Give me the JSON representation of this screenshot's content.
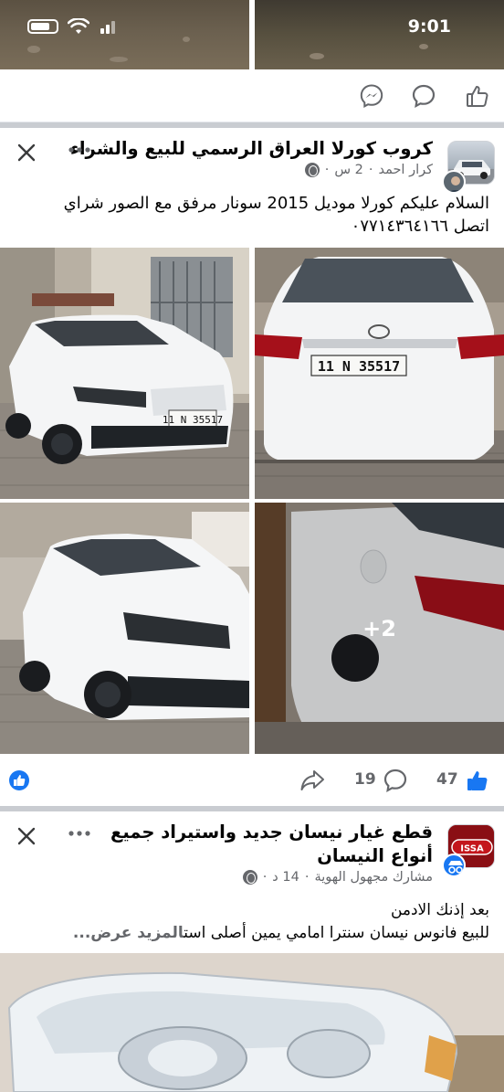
{
  "status_bar": {
    "time": "9:01"
  },
  "colors": {
    "accent": "#1877f2",
    "secondary_text": "#65676b",
    "brand_badge": "#c4161c"
  },
  "post1": {
    "group_name": "كروب كورلا العراق الرسمي للبيع والشراء",
    "author": "كرار احمد",
    "time": "2 س",
    "text_line1": "السلام عليكم كورلا موديل 2015 سونار مرفق مع الصور شراي",
    "text_line2": "اتصل ٠٧٧١٤٣٦٤١٦٦",
    "plate": "11 N 35517",
    "more_photos": "+2",
    "likes": "47",
    "comments": "19"
  },
  "post2": {
    "page_name_line1": "قطع غيار نيسان جديد واستيراد جميع",
    "page_name_line2": "أنواع النيسان",
    "author": "مشارك مجهول الهوية",
    "time": "14 د",
    "line1": "بعد إذنك الادمن",
    "line2": "للبيع فانوس نيسان سنترا امامي يمين أصلى است",
    "see_more": "المزيد عرض...",
    "badge_text": "ISSA"
  },
  "icons": [
    "messenger-icon",
    "comment-icon",
    "like-icon",
    "close-icon",
    "more-icon",
    "share-icon",
    "globe-icon"
  ]
}
